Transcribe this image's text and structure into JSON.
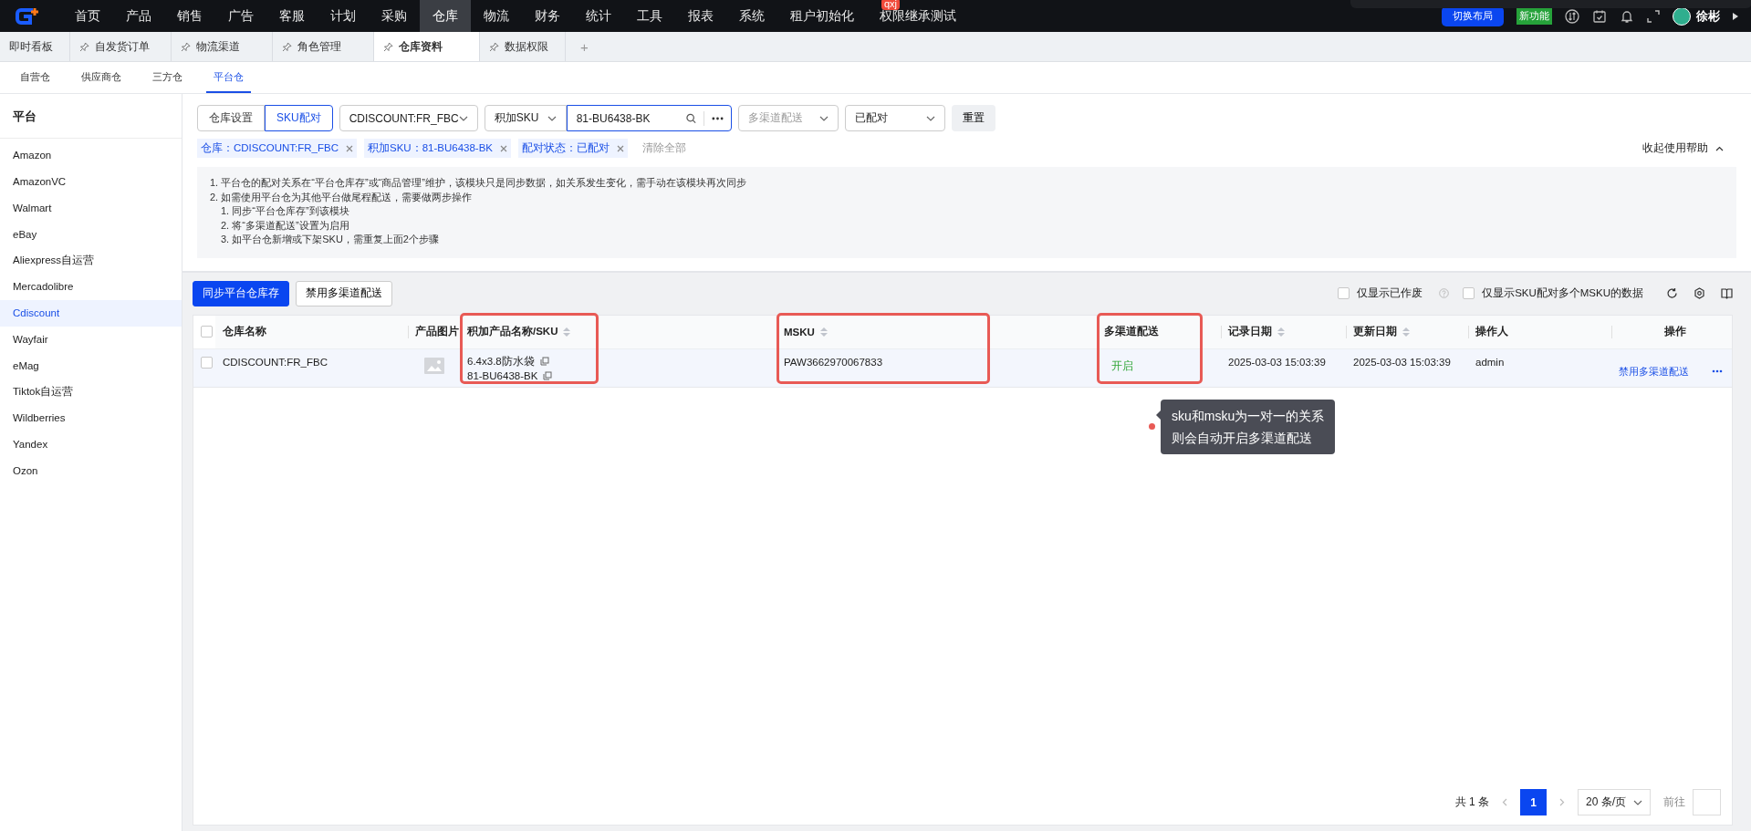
{
  "nav": {
    "items": [
      {
        "label": "首页",
        "selected": false
      },
      {
        "label": "产品",
        "selected": false
      },
      {
        "label": "销售",
        "selected": false
      },
      {
        "label": "广告",
        "selected": false
      },
      {
        "label": "客服",
        "selected": false
      },
      {
        "label": "计划",
        "selected": false
      },
      {
        "label": "采购",
        "selected": false
      },
      {
        "label": "仓库",
        "selected": true
      },
      {
        "label": "物流",
        "selected": false
      },
      {
        "label": "财务",
        "selected": false
      },
      {
        "label": "统计",
        "selected": false
      },
      {
        "label": "工具",
        "selected": false
      },
      {
        "label": "报表",
        "selected": false
      },
      {
        "label": "系统",
        "selected": false
      },
      {
        "label": "租户初始化",
        "selected": false
      },
      {
        "label": "权限继承测试",
        "selected": false,
        "badge": "qxj"
      }
    ],
    "switch_layout": "切换布局",
    "new_feature": "新功能",
    "user_name": "徐彬"
  },
  "tabs": [
    {
      "label": "即时看板",
      "selected": false,
      "pinned": false
    },
    {
      "label": "自发货订单",
      "selected": false,
      "pinned": true
    },
    {
      "label": "物流渠道",
      "selected": false,
      "pinned": true
    },
    {
      "label": "角色管理",
      "selected": false,
      "pinned": true
    },
    {
      "label": "仓库资料",
      "selected": true,
      "pinned": true
    },
    {
      "label": "数据权限",
      "selected": false,
      "pinned": true
    }
  ],
  "add_tab": "+",
  "sub_tabs": [
    {
      "label": "自营仓",
      "selected": false
    },
    {
      "label": "供应商仓",
      "selected": false
    },
    {
      "label": "三方仓",
      "selected": false
    },
    {
      "label": "平台仓",
      "selected": true
    }
  ],
  "sidebar": {
    "title": "平台",
    "items": [
      {
        "label": "Amazon",
        "selected": false
      },
      {
        "label": "AmazonVC",
        "selected": false
      },
      {
        "label": "Walmart",
        "selected": false
      },
      {
        "label": "eBay",
        "selected": false
      },
      {
        "label": "Aliexpress自运营",
        "selected": false
      },
      {
        "label": "Mercadolibre",
        "selected": false
      },
      {
        "label": "Cdiscount",
        "selected": true
      },
      {
        "label": "Wayfair",
        "selected": false
      },
      {
        "label": "eMag",
        "selected": false
      },
      {
        "label": "Tiktok自运营",
        "selected": false
      },
      {
        "label": "Wildberries",
        "selected": false
      },
      {
        "label": "Yandex",
        "selected": false
      },
      {
        "label": "Ozon",
        "selected": false
      }
    ]
  },
  "filters": {
    "segments": [
      {
        "label": "仓库设置",
        "selected": false
      },
      {
        "label": "SKU配对",
        "selected": true
      }
    ],
    "warehouse": "CDISCOUNT:FR_FBC",
    "search_type": "积加SKU",
    "search_value": "81-BU6438-BK",
    "channel_placeholder": "多渠道配送",
    "status": "已配对",
    "reset": "重置"
  },
  "chips": [
    {
      "label": "仓库：CDISCOUNT:FR_FBC"
    },
    {
      "label": "积加SKU：81-BU6438-BK"
    },
    {
      "label": "配对状态：已配对"
    }
  ],
  "clear_all": "清除全部",
  "help_toggle": "收起使用帮助",
  "help": [
    {
      "text": "1. 平台仓的配对关系在“平台仓库存”或“商品管理”维护，该模块只是同步数据，如关系发生变化，需手动在该模块再次同步"
    },
    {
      "text": "2. 如需使用平台仓为其他平台做尾程配送，需要做两步操作",
      "children": [
        {
          "text": "1. 同步“平台仓库存”到该模块"
        },
        {
          "text": "2. 将“多渠道配送”设置为启用"
        },
        {
          "text": "3. 如平台仓新增或下架SKU，需重复上面2个步骤"
        }
      ]
    }
  ],
  "toolbar": {
    "buttons": [
      {
        "label": "同步平台仓库存",
        "kind": "primary"
      },
      {
        "label": "禁用多渠道配送",
        "kind": "default"
      }
    ],
    "checkboxes": [
      {
        "label": "仅显示已作废",
        "checked": false,
        "help": true
      },
      {
        "label": "仅显示SKU配对多个MSKU的数据",
        "checked": false,
        "help": false
      }
    ]
  },
  "table": {
    "all_checked": false,
    "columns": [
      {
        "label": "仓库名称",
        "sortable": false,
        "highlighted": false
      },
      {
        "label": "产品图片",
        "sortable": false,
        "highlighted": false
      },
      {
        "label": "积加产品名称/SKU",
        "sortable": true,
        "highlighted": true
      },
      {
        "label": "MSKU",
        "sortable": true,
        "highlighted": true
      },
      {
        "label": "多渠道配送",
        "sortable": false,
        "highlighted": true
      },
      {
        "label": "记录日期",
        "sortable": true,
        "highlighted": false
      },
      {
        "label": "更新日期",
        "sortable": true,
        "highlighted": false
      },
      {
        "label": "操作人",
        "sortable": false,
        "highlighted": false
      },
      {
        "label": "操作",
        "sortable": false,
        "highlighted": false
      }
    ],
    "rows": [
      {
        "checked": false,
        "warehouse": "CDISCOUNT:FR_FBC",
        "product_name": "6.4x3.8防水袋",
        "sku": "81-BU6438-BK",
        "msku": "PAW3662970067833",
        "channel": {
          "label": "开启",
          "on": true
        },
        "recorded": "2025-03-03 15:03:39",
        "updated": "2025-03-03 15:03:39",
        "operator": "admin",
        "action": "禁用多渠道配送"
      }
    ]
  },
  "tooltip": {
    "lines": [
      "sku和msku为一对一的关系",
      "则会自动开启多渠道配送"
    ]
  },
  "pagination": {
    "total": "共 1 条",
    "pages": [
      {
        "label": "1",
        "selected": true
      }
    ],
    "page_size": "20 条/页",
    "goto": "前往"
  }
}
